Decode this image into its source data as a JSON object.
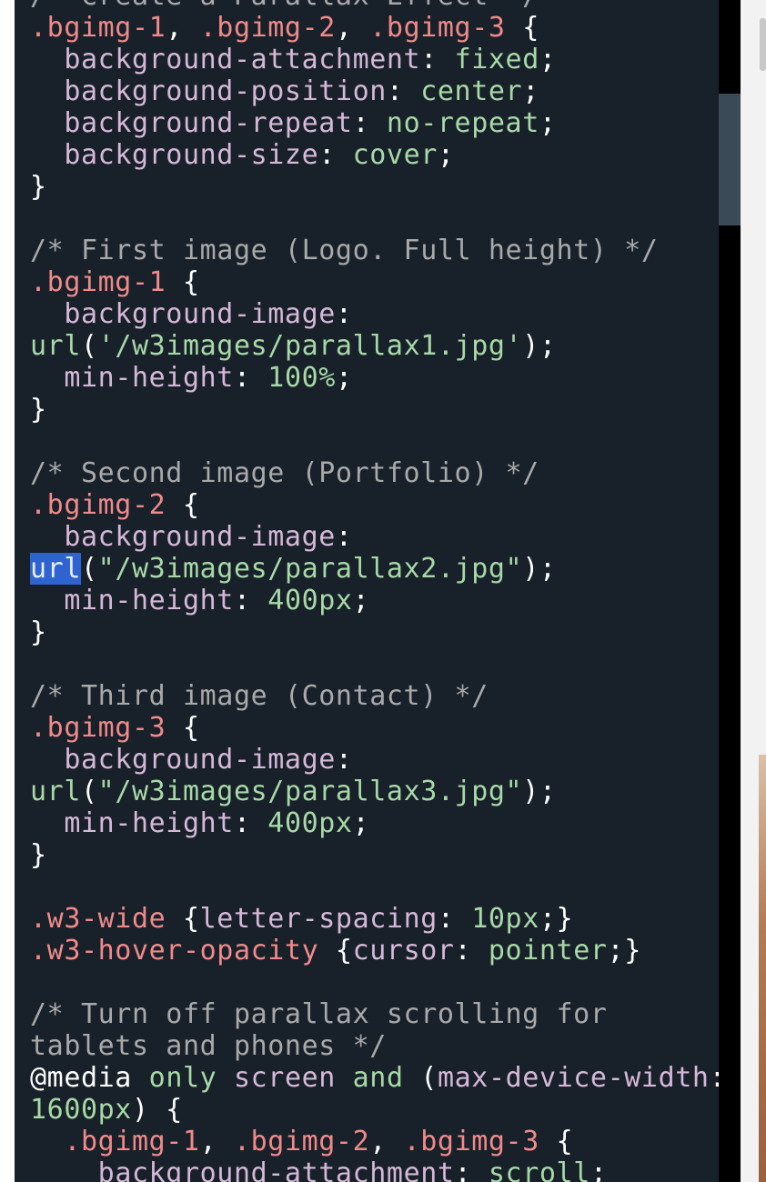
{
  "editor": {
    "lines": [
      [
        {
          "t": "/* Create a Parallax Effect */",
          "c": "c-comment"
        }
      ],
      [
        {
          "t": ".bgimg-1",
          "c": "c-selector"
        },
        {
          "t": ", ",
          "c": "c-punct"
        },
        {
          "t": ".bgimg-2",
          "c": "c-selector"
        },
        {
          "t": ", ",
          "c": "c-punct"
        },
        {
          "t": ".bgimg-3",
          "c": "c-selector"
        },
        {
          "t": " {",
          "c": "c-punct"
        }
      ],
      [
        {
          "t": "  ",
          "c": "c-punct"
        },
        {
          "t": "background-attachment",
          "c": "c-prop"
        },
        {
          "t": ": ",
          "c": "c-punct"
        },
        {
          "t": "fixed",
          "c": "c-value"
        },
        {
          "t": ";",
          "c": "c-punct"
        }
      ],
      [
        {
          "t": "  ",
          "c": "c-punct"
        },
        {
          "t": "background-position",
          "c": "c-prop"
        },
        {
          "t": ": ",
          "c": "c-punct"
        },
        {
          "t": "center",
          "c": "c-value"
        },
        {
          "t": ";",
          "c": "c-punct"
        }
      ],
      [
        {
          "t": "  ",
          "c": "c-punct"
        },
        {
          "t": "background-repeat",
          "c": "c-prop"
        },
        {
          "t": ": ",
          "c": "c-punct"
        },
        {
          "t": "no-repeat",
          "c": "c-value"
        },
        {
          "t": ";",
          "c": "c-punct"
        }
      ],
      [
        {
          "t": "  ",
          "c": "c-punct"
        },
        {
          "t": "background-size",
          "c": "c-prop"
        },
        {
          "t": ": ",
          "c": "c-punct"
        },
        {
          "t": "cover",
          "c": "c-value"
        },
        {
          "t": ";",
          "c": "c-punct"
        }
      ],
      [
        {
          "t": "}",
          "c": "c-punct"
        }
      ],
      [],
      [
        {
          "t": "/* First image (Logo. Full height) */",
          "c": "c-comment"
        }
      ],
      [
        {
          "t": ".bgimg-1",
          "c": "c-selector"
        },
        {
          "t": " {",
          "c": "c-punct"
        }
      ],
      [
        {
          "t": "  ",
          "c": "c-punct"
        },
        {
          "t": "background-image",
          "c": "c-prop"
        },
        {
          "t": ":",
          "c": "c-punct"
        }
      ],
      [
        {
          "t": "url",
          "c": "c-value"
        },
        {
          "t": "(",
          "c": "c-punct"
        },
        {
          "t": "'/w3images/parallax1.jpg'",
          "c": "c-string"
        },
        {
          "t": ");",
          "c": "c-punct"
        }
      ],
      [
        {
          "t": "  ",
          "c": "c-punct"
        },
        {
          "t": "min-height",
          "c": "c-prop"
        },
        {
          "t": ": ",
          "c": "c-punct"
        },
        {
          "t": "100%",
          "c": "c-value"
        },
        {
          "t": ";",
          "c": "c-punct"
        }
      ],
      [
        {
          "t": "}",
          "c": "c-punct"
        }
      ],
      [],
      [
        {
          "t": "/* Second image (Portfolio) */",
          "c": "c-comment"
        }
      ],
      [
        {
          "t": ".bgimg-2",
          "c": "c-selector"
        },
        {
          "t": " {",
          "c": "c-punct"
        }
      ],
      [
        {
          "t": "  ",
          "c": "c-punct"
        },
        {
          "t": "background-image",
          "c": "c-prop"
        },
        {
          "t": ":",
          "c": "c-punct"
        }
      ],
      [
        {
          "t": "url",
          "c": "c-sel-hl"
        },
        {
          "t": "(",
          "c": "c-punct"
        },
        {
          "t": "\"/w3images/parallax2.jpg\"",
          "c": "c-string"
        },
        {
          "t": ");",
          "c": "c-punct"
        }
      ],
      [
        {
          "t": "  ",
          "c": "c-punct"
        },
        {
          "t": "min-height",
          "c": "c-prop"
        },
        {
          "t": ": ",
          "c": "c-punct"
        },
        {
          "t": "400px",
          "c": "c-value"
        },
        {
          "t": ";",
          "c": "c-punct"
        }
      ],
      [
        {
          "t": "}",
          "c": "c-punct"
        }
      ],
      [],
      [
        {
          "t": "/* Third image (Contact) */",
          "c": "c-comment"
        }
      ],
      [
        {
          "t": ".bgimg-3",
          "c": "c-selector"
        },
        {
          "t": " {",
          "c": "c-punct"
        }
      ],
      [
        {
          "t": "  ",
          "c": "c-punct"
        },
        {
          "t": "background-image",
          "c": "c-prop"
        },
        {
          "t": ":",
          "c": "c-punct"
        }
      ],
      [
        {
          "t": "url",
          "c": "c-value"
        },
        {
          "t": "(",
          "c": "c-punct"
        },
        {
          "t": "\"/w3images/parallax3.jpg\"",
          "c": "c-string"
        },
        {
          "t": ");",
          "c": "c-punct"
        }
      ],
      [
        {
          "t": "  ",
          "c": "c-punct"
        },
        {
          "t": "min-height",
          "c": "c-prop"
        },
        {
          "t": ": ",
          "c": "c-punct"
        },
        {
          "t": "400px",
          "c": "c-value"
        },
        {
          "t": ";",
          "c": "c-punct"
        }
      ],
      [
        {
          "t": "}",
          "c": "c-punct"
        }
      ],
      [],
      [
        {
          "t": ".w3-wide",
          "c": "c-selector"
        },
        {
          "t": " {",
          "c": "c-punct"
        },
        {
          "t": "letter-spacing",
          "c": "c-prop"
        },
        {
          "t": ": ",
          "c": "c-punct"
        },
        {
          "t": "10px",
          "c": "c-value"
        },
        {
          "t": ";}",
          "c": "c-punct"
        }
      ],
      [
        {
          "t": ".w3-hover-opacity",
          "c": "c-selector"
        },
        {
          "t": " {",
          "c": "c-punct"
        },
        {
          "t": "cursor",
          "c": "c-prop"
        },
        {
          "t": ": ",
          "c": "c-punct"
        },
        {
          "t": "pointer",
          "c": "c-value"
        },
        {
          "t": ";}",
          "c": "c-punct"
        }
      ],
      [],
      [
        {
          "t": "/* Turn off parallax scrolling for",
          "c": "c-comment"
        }
      ],
      [
        {
          "t": "tablets and phones */",
          "c": "c-comment"
        }
      ],
      [
        {
          "t": "@media",
          "c": "c-at"
        },
        {
          "t": " ",
          "c": "c-punct"
        },
        {
          "t": "only",
          "c": "c-keyword"
        },
        {
          "t": " ",
          "c": "c-punct"
        },
        {
          "t": "screen",
          "c": "c-prop"
        },
        {
          "t": " ",
          "c": "c-punct"
        },
        {
          "t": "and",
          "c": "c-keyword"
        },
        {
          "t": " (",
          "c": "c-punct"
        },
        {
          "t": "max-device-width",
          "c": "c-prop"
        },
        {
          "t": ":",
          "c": "c-punct"
        }
      ],
      [
        {
          "t": "1600px",
          "c": "c-value"
        },
        {
          "t": ") {",
          "c": "c-punct"
        }
      ],
      [
        {
          "t": "  ",
          "c": "c-punct"
        },
        {
          "t": ".bgimg-1",
          "c": "c-selector"
        },
        {
          "t": ", ",
          "c": "c-punct"
        },
        {
          "t": ".bgimg-2",
          "c": "c-selector"
        },
        {
          "t": ", ",
          "c": "c-punct"
        },
        {
          "t": ".bgimg-3",
          "c": "c-selector"
        },
        {
          "t": " {",
          "c": "c-punct"
        }
      ],
      [
        {
          "t": "    ",
          "c": "c-punct"
        },
        {
          "t": "background-attachment",
          "c": "c-prop"
        },
        {
          "t": ": ",
          "c": "c-punct"
        },
        {
          "t": "scroll",
          "c": "c-value"
        },
        {
          "t": ";",
          "c": "c-punct"
        }
      ]
    ]
  },
  "colors": {
    "background": "#182029",
    "selector": "#f08a8a",
    "property": "#d5b8d8",
    "value": "#a7d9a7",
    "comment": "#a9a9a9",
    "selection": "#2f63d0"
  }
}
